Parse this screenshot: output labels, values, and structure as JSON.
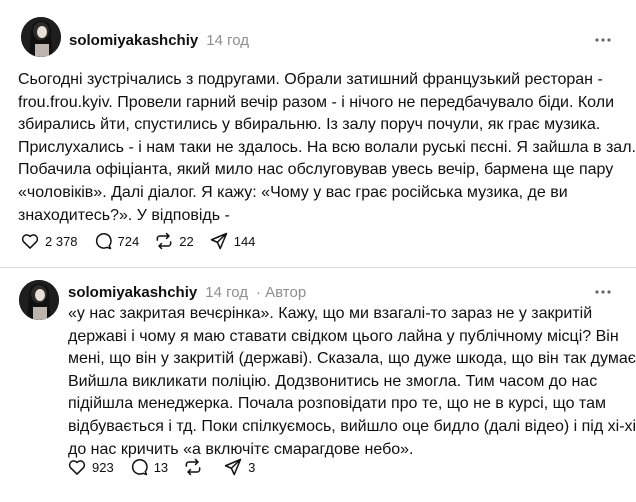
{
  "post1": {
    "username": "solomiyakashchiy",
    "time": "14 год",
    "lines": [
      "Сьогодні зустрічались з подругами. Обрали затишний французький ресторан -",
      "frou.frou.kyiv. Провели гарний вечір разом - і нічого не передбачувало біди. Коли",
      "збирались йти, спустились у вбиральню. Із залу поруч почули, як грає музика.",
      "Прислухались - і нам таки не здалось. На всю волали руські пєсні. Я зайшла в зал.",
      "Побачила офіціанта, який мило нас обслуговував увесь вечір, бармена ще пару",
      "«чоловіків». Далі діалог. Я кажу: «Чому у вас грає російська музика, де ви",
      "знаходитесь?». У відповідь -"
    ],
    "likes": "2 378",
    "replies": "724",
    "reposts": "22",
    "shares": "144"
  },
  "post2": {
    "username": "solomiyakashchiy",
    "time": "14 год",
    "author_label": "· Автор",
    "lines": [
      "«у нас закритая вечєрінка». Кажу, що ми взагалі-то зараз не у закритій",
      "державі і чому я маю ставати свідком цього лайна у публічному місці? Він",
      "мені, що він у закритій (державі). Сказала, що дуже шкода, що він так думає.",
      "Вийшла викликати поліцію. Додзвонитись не змогла. Тим часом до нас",
      "підійшла менеджерка. Почала розповідати про те, що не в курсі, що там",
      "відбувається і тд. Поки спілкуємось, вийшло оце бидло (далі відео) і під хі-хі",
      "до нас кричить «а включітє смарагдове небо»."
    ],
    "likes": "923",
    "replies": "13",
    "reposts": "",
    "shares": "3"
  },
  "icons": {
    "avatar": "avatar-photo",
    "more": "more-horizontal-icon",
    "like": "heart-icon",
    "reply": "comment-icon",
    "repost": "repost-icon",
    "share": "send-icon"
  },
  "colors": {
    "text": "#101010",
    "muted": "#8e8e8e",
    "divider": "#dadada",
    "background": "#ffffff"
  }
}
